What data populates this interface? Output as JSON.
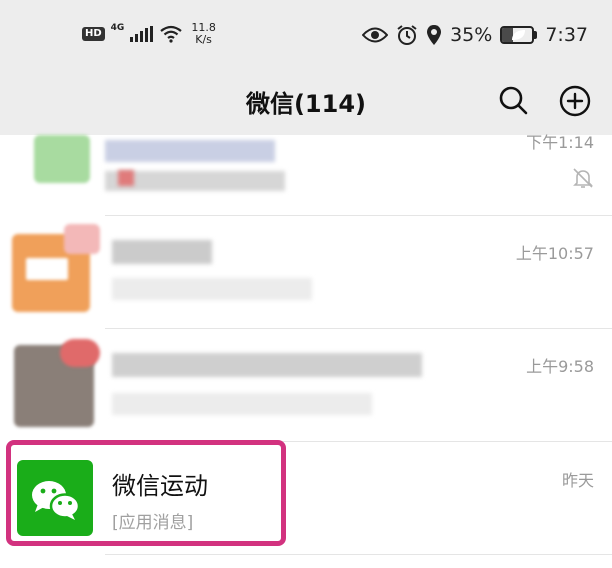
{
  "status_bar": {
    "hd": "HD",
    "network": "4G",
    "speed_value": "11.8",
    "speed_unit": "K/s",
    "battery_percent": "35%",
    "battery_level": 0.35,
    "time": "7:37",
    "icons": [
      "eye-icon",
      "alarm-icon",
      "location-icon",
      "battery-icon",
      "wifi-icon",
      "signal-icon"
    ]
  },
  "header": {
    "title": "微信(114)",
    "icons": [
      "search-icon",
      "add-circle-icon"
    ]
  },
  "chats": [
    {
      "time": "下午1:14",
      "muted": true
    },
    {
      "time": "上午10:57"
    },
    {
      "time": "上午9:58"
    },
    {
      "name": "微信运动",
      "subtitle": "[应用消息]",
      "time": "昨天",
      "highlighted": true
    }
  ],
  "colors": {
    "header_bg": "#ededed",
    "wechat_green": "#1aad19",
    "highlight_border": "#d2327f",
    "time_text": "#9a9a9a"
  }
}
